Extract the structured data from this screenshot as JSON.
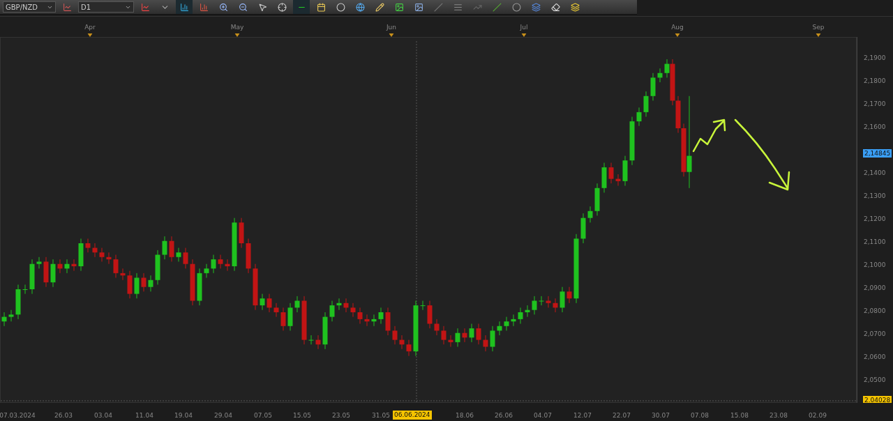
{
  "toolbar": {
    "symbol": "GBP/NZD",
    "timeframe": "D1"
  },
  "months": [
    "Apr",
    "May",
    "Jun",
    "Jul",
    "Aug",
    "Sep"
  ],
  "price_axis": {
    "ticks": [
      "2,1900",
      "2,1800",
      "2,1700",
      "2,1600",
      "2,1400",
      "2,1300",
      "2,1200",
      "2,1100",
      "2,1000",
      "2,0900",
      "2,0800",
      "2,0700",
      "2,0600",
      "2,0500"
    ],
    "current_price": "2,14845",
    "low_marker": "2.04028"
  },
  "date_axis": {
    "labels": [
      "07.03.2024",
      "26.03",
      "03.04",
      "11.04",
      "19.04",
      "29.04",
      "07.05",
      "15.05",
      "23.05",
      "31.05",
      "18.06",
      "26.06",
      "04.07",
      "12.07",
      "22.07",
      "30.07",
      "07.08",
      "15.08",
      "23.08",
      "02.09"
    ],
    "crosshair_date": "06.06.2024"
  }
}
